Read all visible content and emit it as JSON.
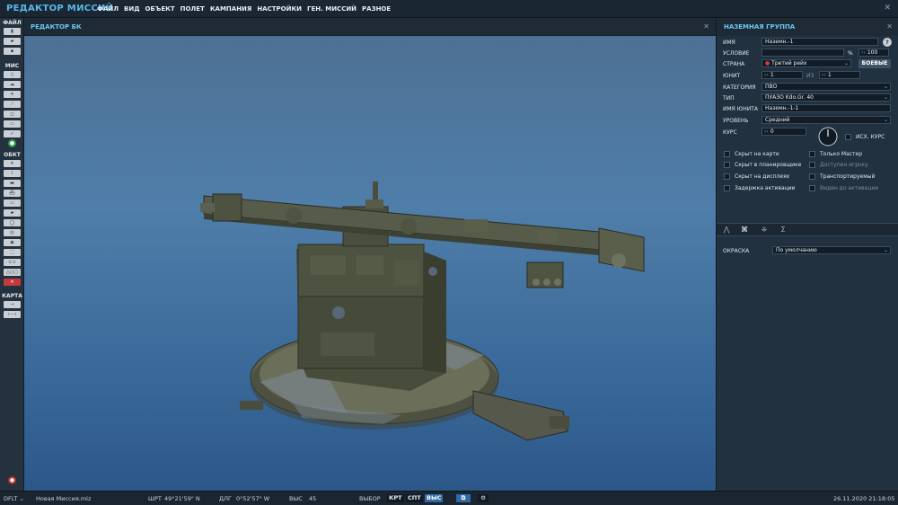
{
  "app": {
    "title": "РЕДАКТОР МИССИЙ",
    "menu": [
      "ФАЙЛ",
      "ВИД",
      "ОБЪЕКТ",
      "ПОЛЕТ",
      "КАМПАНИЯ",
      "НАСТРОЙКИ",
      "ГЕН. МИССИЙ",
      "РАЗНОЕ"
    ]
  },
  "toolbar": {
    "sections": {
      "file": "ФАЙЛ",
      "mission": "МИС",
      "object": "ОБКТ",
      "map": "КАРТА"
    }
  },
  "viewport": {
    "title": "РЕДАКТОР БК"
  },
  "panel": {
    "title": "НАЗЕМНАЯ ГРУППА",
    "help": "?",
    "name_label": "ИМЯ",
    "name_value": "Наземн.-1",
    "condition_label": "УСЛОВИЕ",
    "condition_value": "",
    "condition_unit": "%",
    "condition_percent": "100",
    "country_label": "СТРАНА",
    "country_value": "Третий рейх",
    "combat_button": "БОЕВЫЕ",
    "unit_label": "ЮНИТ",
    "unit_value": "1",
    "of_label": "ИЗ",
    "of_value": "1",
    "category_label": "КАТЕГОРИЯ",
    "category_value": "ПВО",
    "type_label": "ТИП",
    "type_value": "ПУАЗО Kdo.Gr. 40",
    "unit_name_label": "ИМЯ ЮНИТА",
    "unit_name_value": "Наземн.-1-1",
    "level_label": "УРОВЕНЬ",
    "level_value": "Средний",
    "heading_label": "КУРС",
    "heading_value": "0",
    "init_heading_label": "ИСХ. КУРС",
    "checkboxes_left": [
      "Скрыт на карте",
      "Скрыт в планировщике",
      "Скрыт на дисплеях",
      "Задержка активации"
    ],
    "checkboxes_right": [
      "Только Мастер",
      "Доступен игроку",
      "Транспортируемый",
      "Виден до активации"
    ],
    "paint_label": "ОКРАСКА",
    "paint_value": "По умолчанию"
  },
  "status": {
    "profile": "DFLT",
    "mission_file": "Новая Миссия.miz",
    "lat_label": "ШРТ",
    "lat_value": "49°21'59\" N",
    "lon_label": "ДЛГ",
    "lon_value": "0°52'57\" W",
    "alt_label": "ВЫС",
    "alt_value": "45",
    "select_label": "ВЫБОР",
    "btn_map": "КРТ",
    "btn_sat": "СПТ",
    "btn_alt": "ВЫС",
    "datetime": "26.11.2020 21:18:05"
  },
  "colors": {
    "accent": "#58b8ea",
    "panel_bg": "#223140",
    "sky_top": "#4d6f91",
    "sky_bottom": "#2b5888",
    "active_button": "#2f6aa6",
    "country_marker": "#d63c3c"
  }
}
